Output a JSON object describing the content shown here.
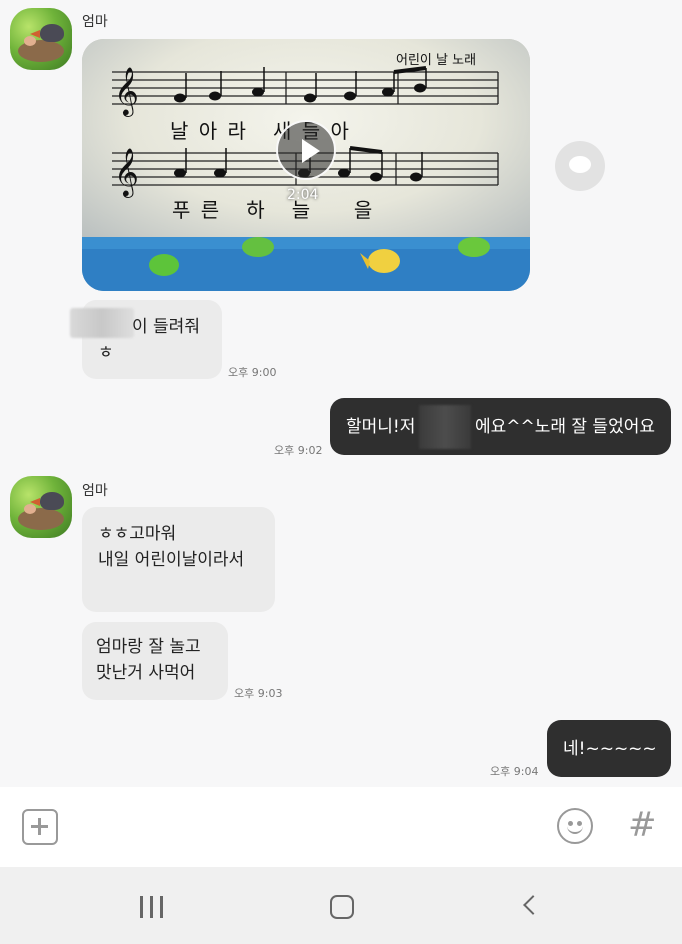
{
  "chat": {
    "sender_name": "엄마",
    "video": {
      "title_text": "어린이 날 노래",
      "lyric_line1": "날 아 라   새 들 아",
      "lyric_line2": "푸 른   하   늘     을",
      "duration": "2:04"
    },
    "messages": [
      {
        "text_suffix": "이 들려줘",
        "text_line2": "ㅎ",
        "time": "오후 9:00"
      },
      {
        "text_prefix": "할머니!저",
        "text_suffix": "에요^^노래 잘 들었어요",
        "time": "오후 9:02"
      },
      {
        "text": "ㅎㅎ고마워\n내일 어린이날이라서\n"
      },
      {
        "text": "엄마랑 잘 놀고\n맛난거  사먹어",
        "time": "오후 9:03"
      },
      {
        "text": "네!~~~~~",
        "time": "오후 9:04"
      }
    ]
  },
  "input_bar": {
    "attach_icon": "plus-square-icon",
    "emoji_icon": "smiley-icon",
    "hashtag_icon": "hashtag-icon",
    "hashtag_glyph": "#"
  },
  "nav_bar": {
    "icons": [
      "recent-apps-icon",
      "home-icon",
      "back-icon"
    ]
  }
}
